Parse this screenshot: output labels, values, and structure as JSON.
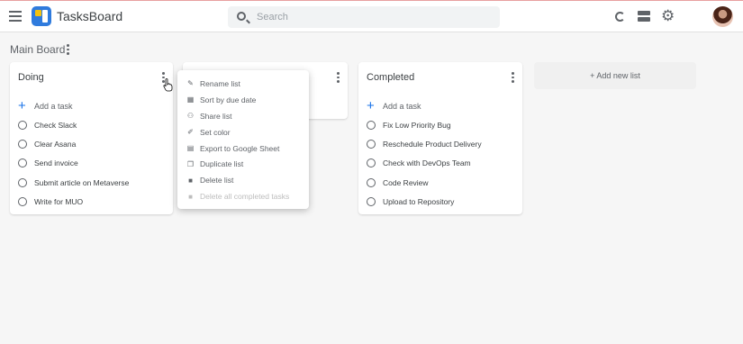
{
  "app": {
    "title": "TasksBoard"
  },
  "search": {
    "placeholder": "Search"
  },
  "board": {
    "title": "Main Board"
  },
  "lists": [
    {
      "title": "Doing",
      "add_task": "Add a task",
      "tasks": [
        "Check Slack",
        "Clear Asana",
        "Send invoice",
        "Submit article on Metaverse",
        "Write for MUO"
      ]
    },
    {
      "title": ""
    },
    {
      "title": "Completed",
      "add_task": "Add a task",
      "tasks": [
        "Fix Low Priority Bug",
        "Reschedule Product Delivery",
        "Check with DevOps Team",
        "Code Review",
        "Upload to Repository"
      ]
    }
  ],
  "add_list": "+ Add new list",
  "context_menu": {
    "items": [
      {
        "label": "Rename list",
        "icon": "pencil-icon"
      },
      {
        "label": "Sort by due date",
        "icon": "calendar-icon"
      },
      {
        "label": "Share list",
        "icon": "people-icon"
      },
      {
        "label": "Set color",
        "icon": "brush-icon"
      },
      {
        "label": "Export to Google Sheet",
        "icon": "sheet-icon"
      },
      {
        "label": "Duplicate list",
        "icon": "copy-icon"
      },
      {
        "label": "Delete list",
        "icon": "trash-icon"
      },
      {
        "label": "Delete all completed tasks",
        "icon": "trash-icon",
        "disabled": true
      }
    ]
  },
  "colors": {
    "accent": "#1a73e8",
    "logo": "#2f7bdd",
    "logo_square": "#f4c20d"
  }
}
